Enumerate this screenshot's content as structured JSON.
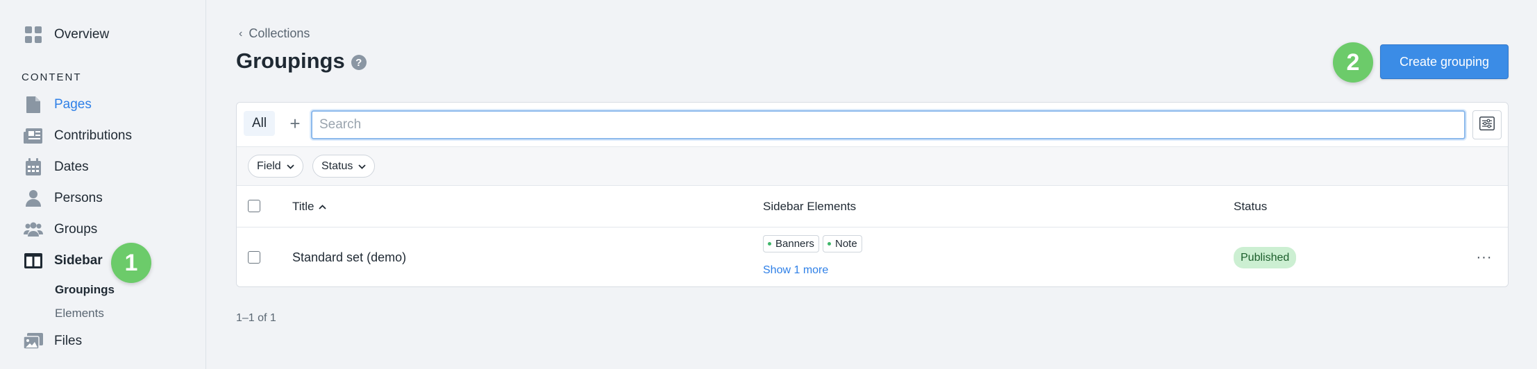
{
  "sidebar": {
    "overview": "Overview",
    "section_content": "CONTENT",
    "items": [
      {
        "label": "Pages"
      },
      {
        "label": "Contributions"
      },
      {
        "label": "Dates"
      },
      {
        "label": "Persons"
      },
      {
        "label": "Groups"
      },
      {
        "label": "Sidebar"
      },
      {
        "label": "Files"
      }
    ],
    "subitems": [
      {
        "label": "Groupings"
      },
      {
        "label": "Elements"
      }
    ]
  },
  "badges": {
    "one": "1",
    "two": "2"
  },
  "header": {
    "breadcrumb": "Collections",
    "title": "Groupings",
    "help": "?",
    "create_button": "Create grouping"
  },
  "toolbar": {
    "tab_all": "All",
    "add": "+",
    "search_placeholder": "Search"
  },
  "filters": [
    {
      "label": "Field"
    },
    {
      "label": "Status"
    }
  ],
  "table": {
    "columns": [
      "Title",
      "Sidebar Elements",
      "Status"
    ],
    "rows": [
      {
        "title": "Standard set (demo)",
        "tags": [
          "Banners",
          "Note"
        ],
        "show_more": "Show 1 more",
        "status": "Published",
        "actions": "···"
      }
    ]
  },
  "pagination": "1–1 of 1",
  "colors": {
    "accent": "#3b8ce6",
    "badge": "#6ccb6a",
    "published_bg": "#ccefd2"
  }
}
